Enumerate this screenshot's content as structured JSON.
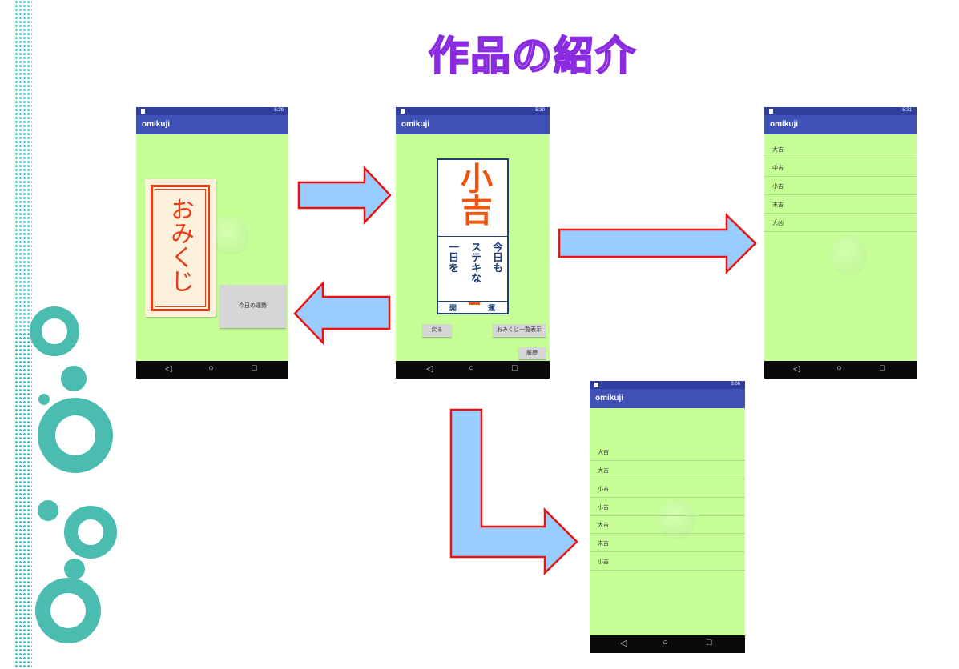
{
  "slide": {
    "title": "作品の紹介"
  },
  "app": {
    "name": "omikuji"
  },
  "phones": {
    "home": {
      "time": "5:29",
      "card_text": "おみくじ",
      "fortune_button": "今日の運勢"
    },
    "result": {
      "time": "5:30",
      "fortune": "小吉",
      "message_col1": "今日も",
      "message_col2": "ステキな",
      "message_col3": "一日を",
      "footer_left": "開",
      "footer_right": "運",
      "back_button": "戻る",
      "list_button": "おみくじ一覧表示",
      "history_button": "履歴"
    },
    "list": {
      "time": "5:31",
      "items": [
        "大吉",
        "中吉",
        "小吉",
        "末吉",
        "大凶"
      ]
    },
    "history": {
      "time": "3:06",
      "items": [
        "大吉",
        "大吉",
        "小吉",
        "小吉",
        "大吉",
        "末吉",
        "小吉"
      ]
    }
  },
  "nav": {
    "back": "◁",
    "home": "○",
    "recent": "□"
  },
  "colors": {
    "accent": "#3f51b5",
    "statusbar": "#303f9f",
    "screen_bg": "#c5ff96",
    "arrow_fill": "#99ccff",
    "arrow_border": "#ee1111",
    "title_stroke": "#8a2be2",
    "teal": "#4bbcb0"
  }
}
